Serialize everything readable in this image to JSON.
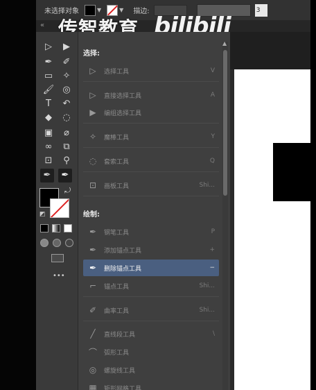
{
  "control_bar": {
    "selection_label": "未选择对象",
    "stroke_label": "描边:",
    "value": "3"
  },
  "watermark": {
    "cn": "传智教育",
    "en": "bilibili"
  },
  "toolbar": {
    "tools": [
      {
        "name": "selection-tool",
        "icon": "arrow-outline-icon",
        "glyph": "▷"
      },
      {
        "name": "direct-selection-tool",
        "icon": "arrow-solid-icon",
        "glyph": "▶"
      },
      {
        "name": "pen-tool",
        "icon": "pen-icon",
        "glyph": "✒"
      },
      {
        "name": "curvature-tool",
        "icon": "curvature-icon",
        "glyph": "✐"
      },
      {
        "name": "rectangle-tool",
        "icon": "rectangle-icon",
        "glyph": "▭"
      },
      {
        "name": "magic-brush-tool",
        "icon": "wand-icon",
        "glyph": "✧"
      },
      {
        "name": "paintbrush-tool",
        "icon": "brush-icon",
        "glyph": "🖌"
      },
      {
        "name": "spiral-tool",
        "icon": "spiral-icon",
        "glyph": "◎"
      },
      {
        "name": "type-tool",
        "icon": "type-icon",
        "glyph": "T"
      },
      {
        "name": "rotate-tool",
        "icon": "rotate-icon",
        "glyph": "↶"
      },
      {
        "name": "eraser-tool",
        "icon": "eraser-icon",
        "glyph": "◆"
      },
      {
        "name": "lasso-tool",
        "icon": "lasso-icon",
        "glyph": "◌"
      },
      {
        "name": "gradient-tool",
        "icon": "gradient-icon",
        "glyph": "▣"
      },
      {
        "name": "eyedropper-tool",
        "icon": "eyedropper-icon",
        "glyph": "⌀"
      },
      {
        "name": "blend-tool",
        "icon": "blend-icon",
        "glyph": "∞"
      },
      {
        "name": "shape-builder-tool",
        "icon": "shape-builder-icon",
        "glyph": "⧉"
      },
      {
        "name": "crop-tool",
        "icon": "crop-icon",
        "glyph": "⊡"
      },
      {
        "name": "zoom-tool",
        "icon": "zoom-icon",
        "glyph": "⚲"
      },
      {
        "name": "add-anchor-tool",
        "icon": "pen-plus-icon",
        "glyph": "✒"
      },
      {
        "name": "delete-anchor-tool",
        "icon": "pen-minus-icon",
        "glyph": "✒"
      }
    ],
    "more_label": "•••"
  },
  "flyout": {
    "section_select": "选择:",
    "section_draw": "绘制:",
    "items": [
      {
        "label": "选择工具",
        "shortcut": "V",
        "icon": "arrow-outline-icon",
        "glyph": "▷"
      },
      {
        "label": "直接选择工具",
        "shortcut": "A",
        "icon": "arrow-solid-icon",
        "glyph": "▷"
      },
      {
        "label": "编组选择工具",
        "shortcut": "",
        "icon": "group-select-icon",
        "glyph": "▶"
      },
      {
        "label": "魔棒工具",
        "shortcut": "Y",
        "icon": "magic-wand-icon",
        "glyph": "✧"
      },
      {
        "label": "套索工具",
        "shortcut": "Q",
        "icon": "lasso-icon",
        "glyph": "◌"
      },
      {
        "label": "画板工具",
        "shortcut": "Shi...",
        "icon": "artboard-icon",
        "glyph": "⊡"
      },
      {
        "label": "钢笔工具",
        "shortcut": "P",
        "icon": "pen-icon",
        "glyph": "✒"
      },
      {
        "label": "添加锚点工具",
        "shortcut": "+",
        "icon": "pen-plus-icon",
        "glyph": "✒"
      },
      {
        "label": "删除锚点工具",
        "shortcut": "−",
        "icon": "pen-minus-icon",
        "glyph": "✒"
      },
      {
        "label": "锚点工具",
        "shortcut": "Shi...",
        "icon": "anchor-point-icon",
        "glyph": "⌐"
      },
      {
        "label": "曲率工具",
        "shortcut": "Shi...",
        "icon": "curvature-icon",
        "glyph": "✐"
      },
      {
        "label": "直线段工具",
        "shortcut": "\\",
        "icon": "line-icon",
        "glyph": "╱"
      },
      {
        "label": "弧形工具",
        "shortcut": "",
        "icon": "arc-icon",
        "glyph": "⌒"
      },
      {
        "label": "螺旋线工具",
        "shortcut": "",
        "icon": "spiral-icon",
        "glyph": "◎"
      },
      {
        "label": "矩形网格工具",
        "shortcut": "",
        "icon": "grid-icon",
        "glyph": "▦"
      }
    ]
  },
  "colors": {
    "panel": "#3f3f3f",
    "active_item": "#4a5f80",
    "canvas": "#ffffff"
  }
}
